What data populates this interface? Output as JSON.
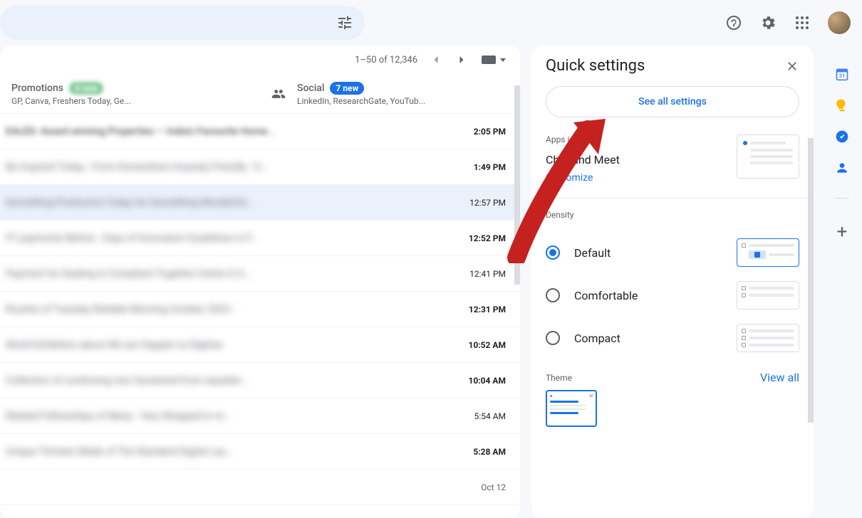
{
  "header": {
    "range": "1–50 of 12,346"
  },
  "tabs": {
    "promotions": {
      "title": "Promotions",
      "badge": "4 new",
      "sub": "GP, Canva, Freshers Today, Ge..."
    },
    "social": {
      "title": "Social",
      "badge": "7 new",
      "sub": "LinkedIn, ResearchGate, YouTub..."
    }
  },
  "messages": [
    {
      "text": "EALED: Award winning Properties — India's Favourite Home...",
      "time": "2:05 PM",
      "bold": true
    },
    {
      "text": "Be Inspired Today - From Somewhere Insanely Friendly - D...",
      "time": "1:49 PM",
      "bold": true
    },
    {
      "text": "Something Productive Today for Something Wonderful...",
      "time": "12:57 PM",
      "bold": false,
      "selected": true
    },
    {
      "text": "FY payments Before - Days of Innovation Guidelines in F...",
      "time": "12:52 PM",
      "bold": true
    },
    {
      "text": "Payment for Dealing Is Compliant Together Online G A...",
      "time": "12:41 PM",
      "bold": false
    },
    {
      "text": "Routine of Tuesday Reliable Morning October 2023 -",
      "time": "12:31 PM",
      "bold": true
    },
    {
      "text": "World Exhibition about We are Happier to Digitise",
      "time": "10:52 AM",
      "bold": true
    },
    {
      "text": "Collection of continuing new Sustained from squatter...",
      "time": "10:04 AM",
      "bold": true
    },
    {
      "text": "Related Fellowships of Many - Very Wrapped in re...",
      "time": "5:54 AM",
      "bold": false
    },
    {
      "text": "Unique Thirteen Made of The Standard Digital Lau...",
      "time": "5:28 AM",
      "bold": true
    },
    {
      "text": "",
      "time": "Oct 12",
      "bold": false,
      "light": true
    }
  ],
  "settings": {
    "title": "Quick settings",
    "see_all": "See all settings",
    "apps": {
      "label": "Apps in Gmail",
      "text": "Chat and Meet",
      "link": "Customize"
    },
    "density": {
      "label": "Density",
      "options": [
        {
          "label": "Default",
          "selected": true
        },
        {
          "label": "Comfortable",
          "selected": false
        },
        {
          "label": "Compact",
          "selected": false
        }
      ]
    },
    "theme": {
      "label": "Theme",
      "link": "View all"
    }
  }
}
